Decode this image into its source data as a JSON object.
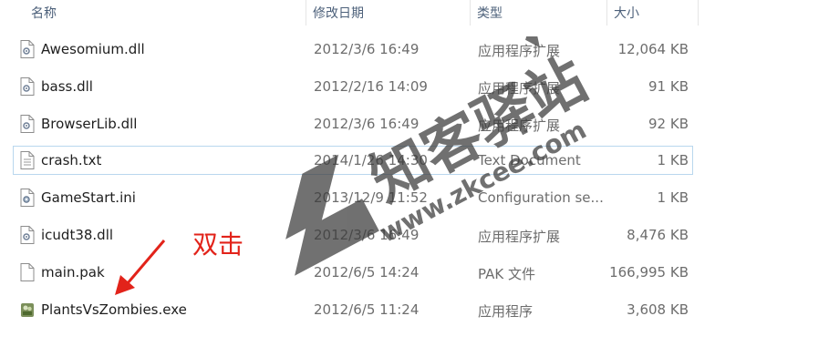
{
  "columns": {
    "name": "名称",
    "modified": "修改日期",
    "type": "类型",
    "size": "大小"
  },
  "files": [
    {
      "name": "Awesomium.dll",
      "modified": "2012/3/6 16:49",
      "type": "应用程序扩展",
      "size": "12,064 KB",
      "icon": "dll-file-icon"
    },
    {
      "name": "bass.dll",
      "modified": "2012/2/16 14:09",
      "type": "应用程序扩展",
      "size": "91 KB",
      "icon": "dll-file-icon"
    },
    {
      "name": "BrowserLib.dll",
      "modified": "2012/3/6 16:49",
      "type": "应用程序扩展",
      "size": "92 KB",
      "icon": "dll-file-icon"
    },
    {
      "name": "crash.txt",
      "modified": "2014/1/26 14:30",
      "type": "Text Document",
      "size": "1 KB",
      "icon": "text-file-icon"
    },
    {
      "name": "GameStart.ini",
      "modified": "2013/12/9 11:52",
      "type": "Configuration se...",
      "size": "1 KB",
      "icon": "ini-file-icon"
    },
    {
      "name": "icudt38.dll",
      "modified": "2012/3/6 16:49",
      "type": "应用程序扩展",
      "size": "8,476 KB",
      "icon": "dll-file-icon"
    },
    {
      "name": "main.pak",
      "modified": "2012/6/5 14:24",
      "type": "PAK 文件",
      "size": "166,995 KB",
      "icon": "blank-file-icon"
    },
    {
      "name": "PlantsVsZombies.exe",
      "modified": "2012/6/5 11:24",
      "type": "应用程序",
      "size": "3,608 KB",
      "icon": "game-exe-icon"
    }
  ],
  "annotation": {
    "label": "双击"
  },
  "watermark": {
    "title": "知客驿站",
    "url": "www.zkcee.com"
  },
  "colors": {
    "annotation": "#e2231a",
    "header_text": "#4c607a",
    "focus_border": "#b9d7ee",
    "watermark": "#3a3a3a"
  }
}
